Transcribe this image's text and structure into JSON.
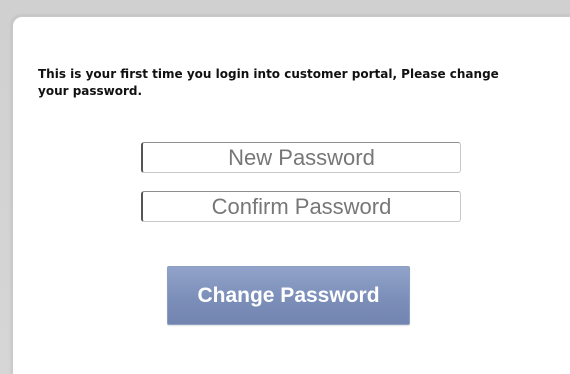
{
  "message": {
    "text": "This is your first time you login into customer portal, Please change your password."
  },
  "form": {
    "new_password": {
      "placeholder": "New Password",
      "value": ""
    },
    "confirm_password": {
      "placeholder": "Confirm Password",
      "value": ""
    },
    "submit_label": "Change Password"
  },
  "colors": {
    "button_top": "#91a3c9",
    "button_bottom": "#7284b0",
    "page_background": "#d4d4d4",
    "panel_background": "#ffffff"
  }
}
